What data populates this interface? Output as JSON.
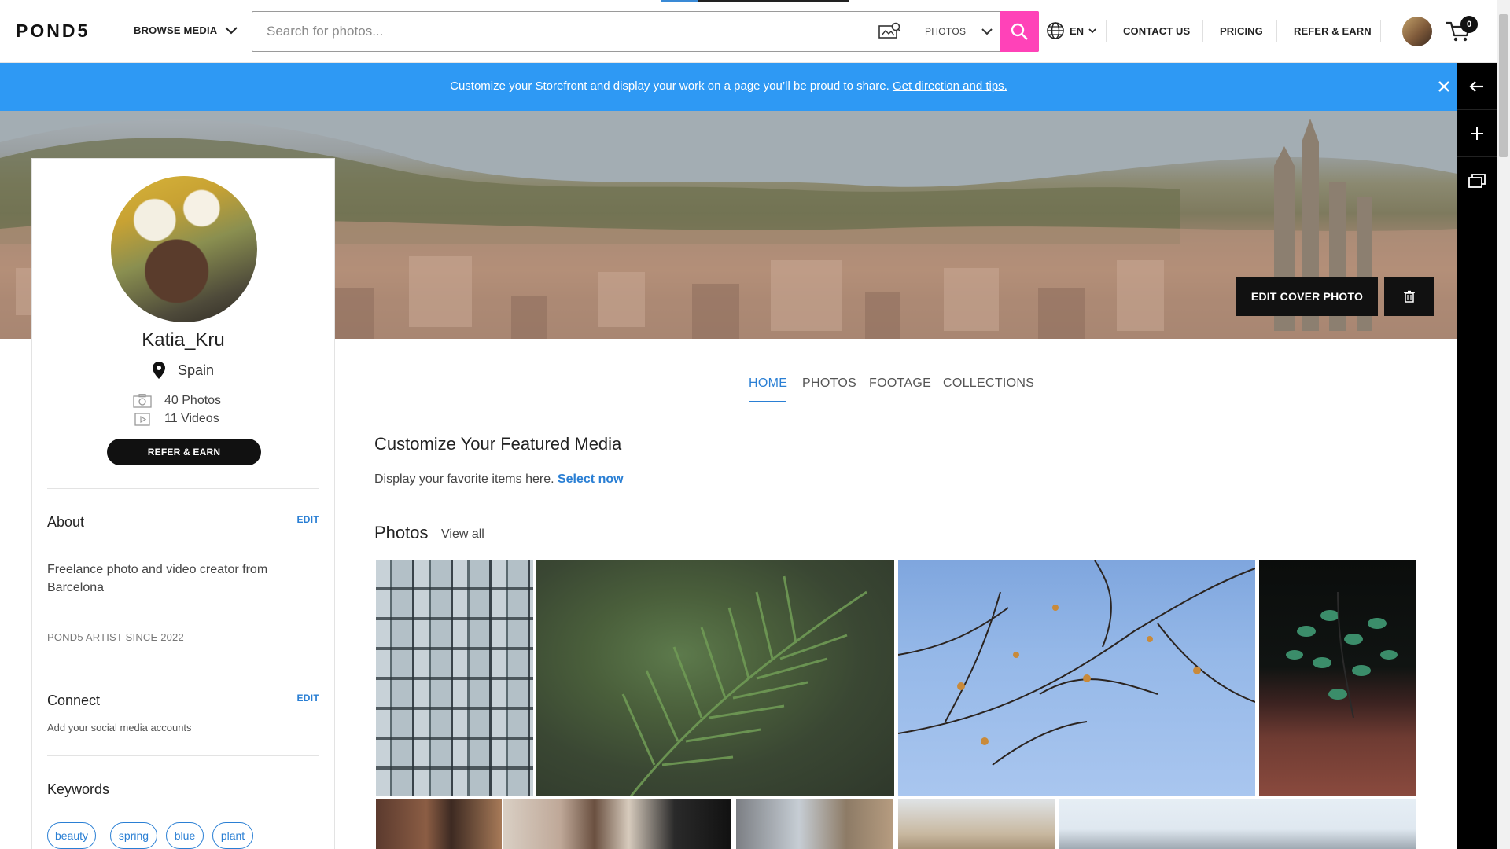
{
  "header": {
    "logo": "POND5",
    "browse_label": "BROWSE MEDIA",
    "search_placeholder": "Search for photos...",
    "media_type": "PHOTOS",
    "language": "EN",
    "nav": [
      "CONTACT US",
      "PRICING",
      "REFER & EARN"
    ],
    "cart_count": "0",
    "accent_color": "#ff42b8"
  },
  "banner": {
    "text": "Customize your Storefront and display your work on a page you’ll be proud to share.",
    "link": "Get direction and tips.",
    "color": "#2e99f4"
  },
  "cover": {
    "edit_label": "EDIT COVER PHOTO"
  },
  "profile": {
    "username": "Katia_Kru",
    "location": "Spain",
    "photos": "40 Photos",
    "videos": "11 Videos",
    "refer_label": "REFER & EARN",
    "about_title": "About",
    "about_edit": "EDIT",
    "about_text": "Freelance photo and video creator from Barcelona",
    "since": "POND5 ARTIST SINCE 2022",
    "connect_title": "Connect",
    "connect_edit": "EDIT",
    "connect_sub": "Add your social media accounts",
    "keywords_title": "Keywords",
    "keywords": [
      "beauty",
      "spring",
      "blue",
      "plant"
    ]
  },
  "main": {
    "tabs": [
      "HOME",
      "PHOTOS",
      "FOOTAGE",
      "COLLECTIONS"
    ],
    "active_tab": "HOME",
    "featured_title": "Customize Your Featured Media",
    "featured_sub": "Display your favorite items here.",
    "featured_link": "Select now",
    "photos_title": "Photos",
    "view_all": "View all",
    "link_color": "#2a7fd4"
  }
}
